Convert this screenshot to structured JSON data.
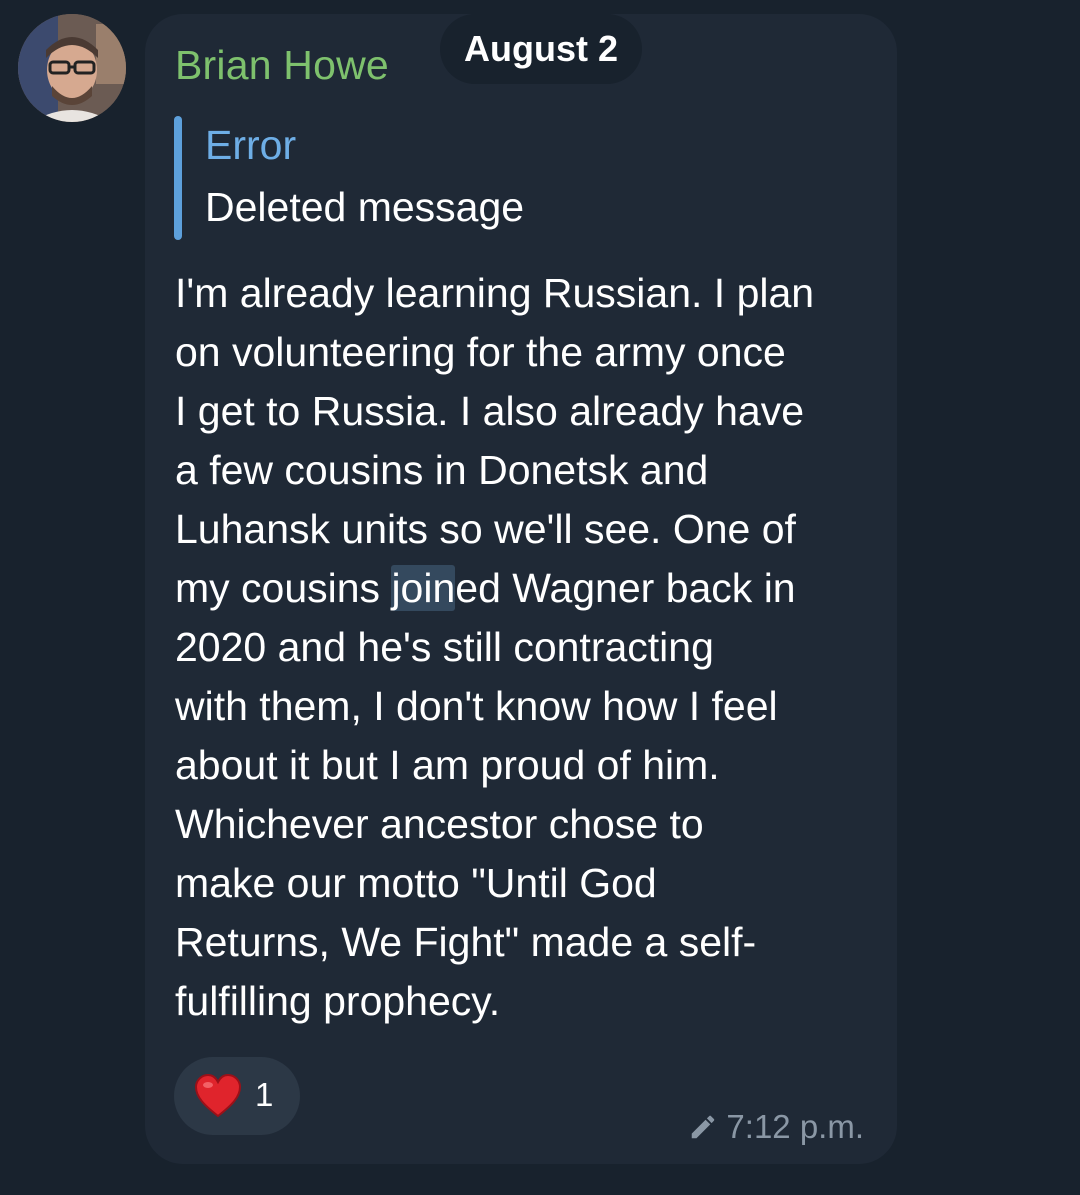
{
  "header": {
    "date": "August 2"
  },
  "message": {
    "sender": "Brian Howe",
    "avatar_icon": "user-avatar",
    "reply": {
      "title": "Error",
      "text": "Deleted message"
    },
    "text_before_selection": "I'm already learning Russian. I plan\non volunteering for the army once\nI get to Russia. I also already have\na few cousins in Donetsk and\nLuhansk units so we'll see. One of\nmy cousins ",
    "selected_text": "join",
    "text_after_selection": "ed Wagner back in\n2020 and he's still contracting\nwith them, I don't know how I feel\nabout it but I am proud of him.\nWhichever ancestor chose to\nmake our motto \"Until God\nReturns, We Fight\" made a self-\nfulfilling prophecy.",
    "reaction": {
      "emoji_icon": "red-heart-icon",
      "count": "1"
    },
    "edited_icon": "pencil-icon",
    "time": "7:12 p.m."
  },
  "colors": {
    "background": "#18222d",
    "bubble": "#1f2936",
    "sender_name": "#7ec16d",
    "reply_accent": "#5da0dc",
    "heart": "#e0242c",
    "meta_text": "#8a97a5"
  }
}
